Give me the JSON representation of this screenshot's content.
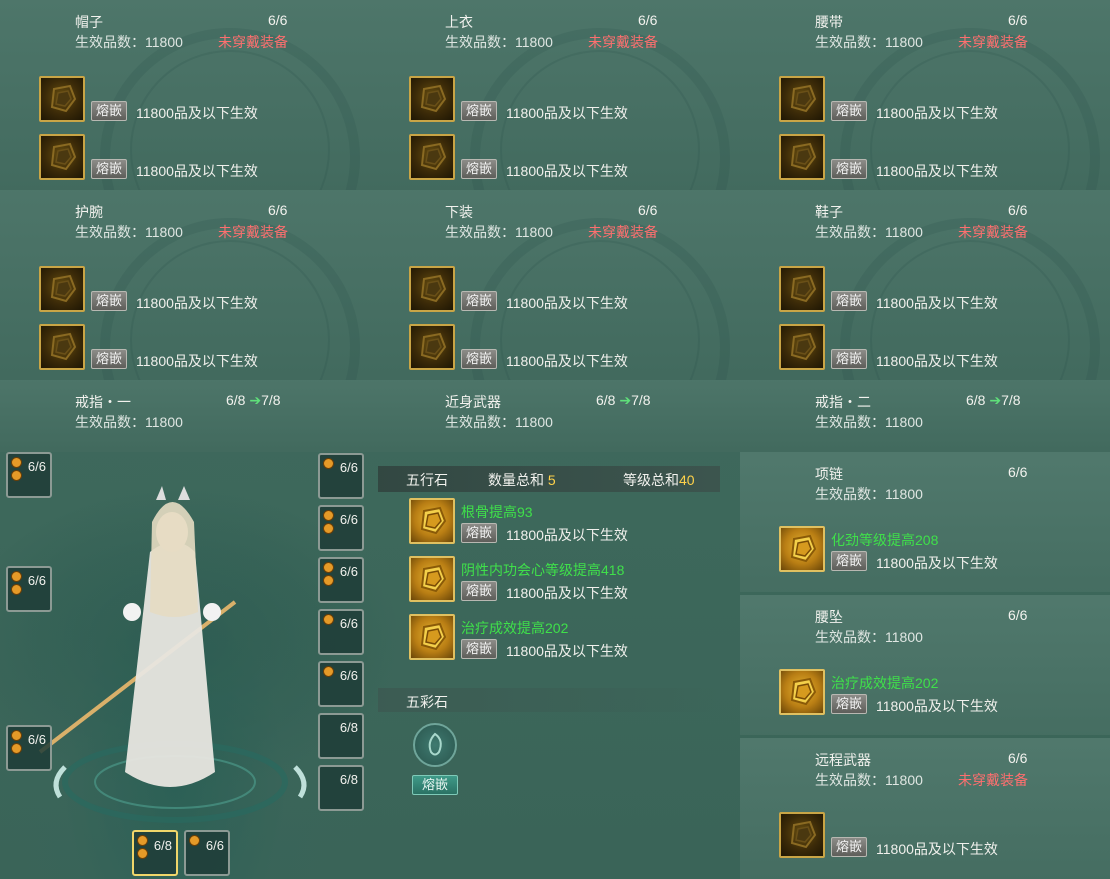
{
  "common": {
    "count_6": "6/6",
    "grade_label": "生效品数：11800",
    "unequipped": "未穿戴装备",
    "inlay_btn": "熔嵌",
    "slot_desc": "11800品及以下生效"
  },
  "panels": [
    {
      "name": "帽子"
    },
    {
      "name": "上衣"
    },
    {
      "name": "腰带"
    },
    {
      "name": "护腕"
    },
    {
      "name": "下装"
    },
    {
      "name": "鞋子"
    }
  ],
  "rings": [
    {
      "name": "戒指・一",
      "count": "6/8",
      "next": "7/8"
    },
    {
      "name": "近身武器",
      "count": "6/8",
      "next": "7/8"
    },
    {
      "name": "戒指・二",
      "count": "6/8",
      "next": "7/8"
    }
  ],
  "wuxing": {
    "title": "五行石",
    "qty_label": "数量总和",
    "qty_value": "5",
    "level_label": "等级总和",
    "level_value": "40",
    "slots": [
      {
        "attr": "根骨提高93"
      },
      {
        "attr": "阴性内功会心等级提高418"
      },
      {
        "attr": "治疗成效提高202"
      }
    ]
  },
  "wucai": {
    "title": "五彩石",
    "button": "熔嵌"
  },
  "right": {
    "necklace": {
      "name": "项链",
      "attr": "化劲等级提高208"
    },
    "pendant": {
      "name": "腰坠",
      "attr": "治疗成效提高202"
    },
    "ranged": {
      "name": "远程武器"
    }
  },
  "character_slots": {
    "left": [
      "6/6",
      "6/6",
      "6/6"
    ],
    "right": [
      "6/6",
      "6/6",
      "6/6",
      "6/6",
      "6/6",
      "6/8",
      "6/8"
    ],
    "bottom": [
      "6/8",
      "6/6"
    ]
  },
  "colors": {
    "warning": "#ff6f6f",
    "attribute_green": "#3fe04a",
    "highlight_yellow": "#ffd24a",
    "gem_gold": "#c9a546"
  }
}
